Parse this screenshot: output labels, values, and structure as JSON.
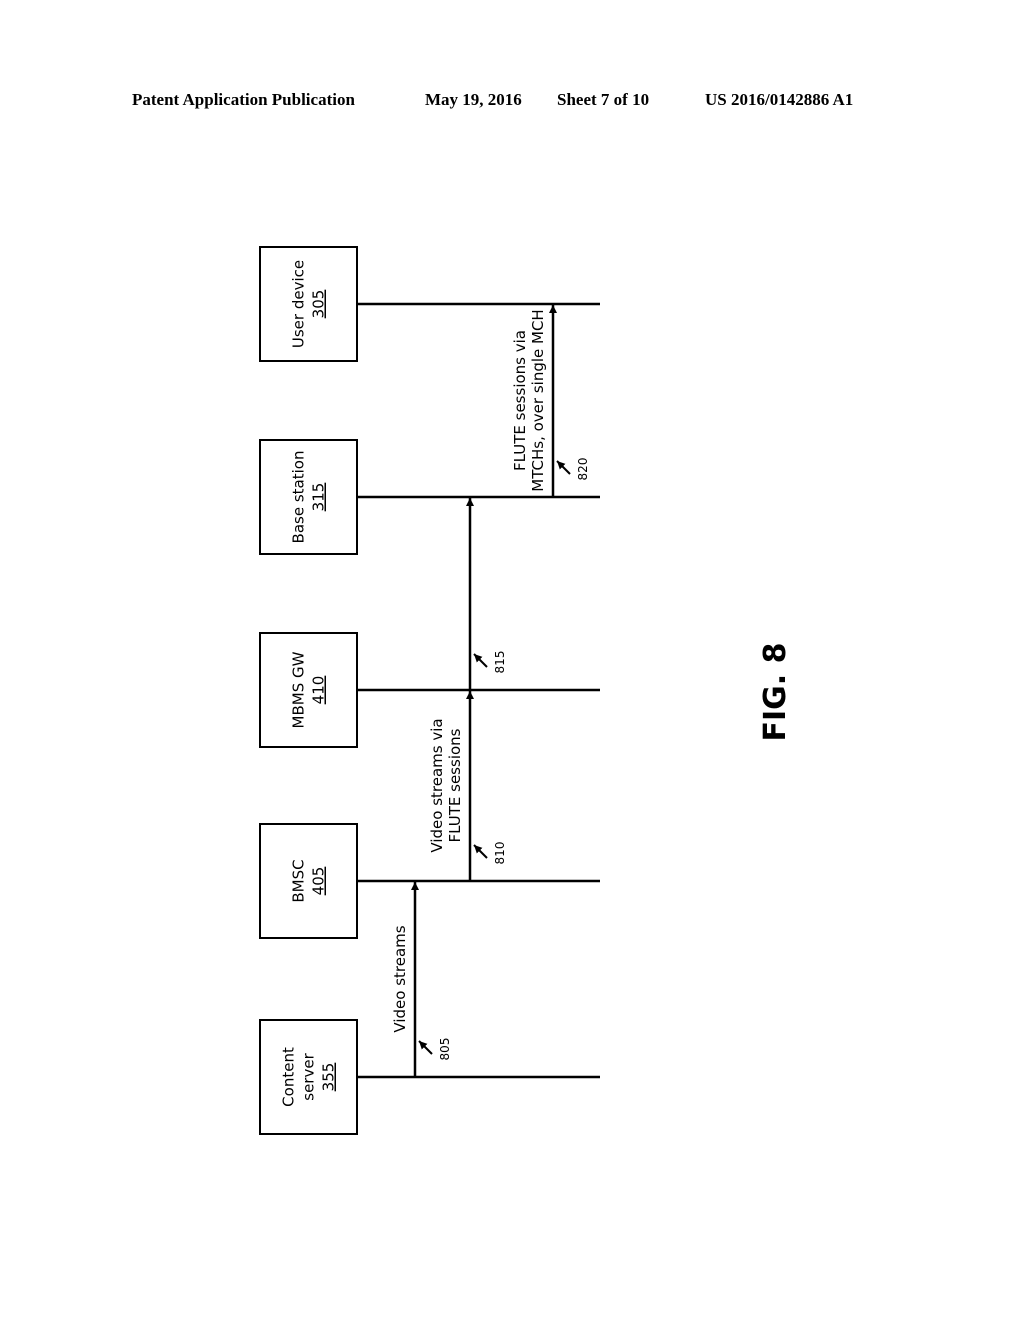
{
  "header": {
    "publication": "Patent Application Publication",
    "date": "May 19, 2016",
    "sheet": "Sheet 7 of 10",
    "number": "US 2016/0142886 A1"
  },
  "figure_label": "FIG. 8",
  "entities": [
    {
      "id": "user_device",
      "lines": [
        "User device"
      ],
      "ref": "305"
    },
    {
      "id": "base_station",
      "lines": [
        "Base station"
      ],
      "ref": "315"
    },
    {
      "id": "mbms_gw",
      "lines": [
        "MBMS GW"
      ],
      "ref": "410"
    },
    {
      "id": "bmsc",
      "lines": [
        "BMSC"
      ],
      "ref": "405"
    },
    {
      "id": "content_server",
      "lines": [
        "Content",
        "server"
      ],
      "ref": "355"
    }
  ],
  "messages": [
    {
      "ref": "805",
      "from": "content_server",
      "to": "bmsc",
      "label_lines": [
        "Video streams"
      ]
    },
    {
      "ref": "810",
      "from": "bmsc",
      "to": "mbms_gw",
      "label_lines": [
        "Video streams via",
        "FLUTE sessions"
      ]
    },
    {
      "ref": "815",
      "from": "mbms_gw",
      "to": "base_station",
      "label_lines": []
    },
    {
      "ref": "820",
      "from": "base_station",
      "to": "user_device",
      "label_lines": [
        "FLUTE sessions via",
        "MTCHs, over single MCH"
      ]
    }
  ]
}
